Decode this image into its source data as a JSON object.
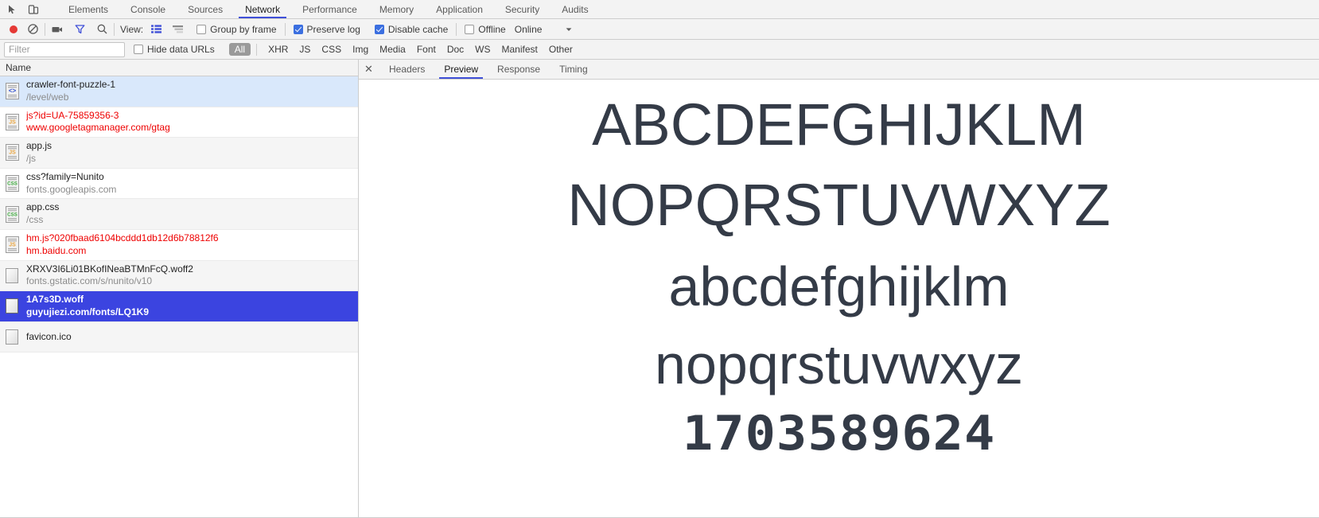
{
  "window": {
    "title": "Chrome DevTools — Network"
  },
  "devtools_tabs": {
    "inspect_icon": "inspect-element-icon",
    "device_icon": "device-toolbar-icon",
    "items": [
      {
        "label": "Elements",
        "active": false
      },
      {
        "label": "Console",
        "active": false
      },
      {
        "label": "Sources",
        "active": false
      },
      {
        "label": "Network",
        "active": true
      },
      {
        "label": "Performance",
        "active": false
      },
      {
        "label": "Memory",
        "active": false
      },
      {
        "label": "Application",
        "active": false
      },
      {
        "label": "Security",
        "active": false
      },
      {
        "label": "Audits",
        "active": false
      }
    ],
    "active_tab": "Network",
    "accent_color": "#4050d8"
  },
  "toolbar": {
    "record_icon": "record-circle-icon",
    "record_color": "#e53935",
    "clear_icon": "clear-no-entry-icon",
    "capture_screenshots_icon": "camera-icon",
    "filter_icon": "funnel-filter-icon",
    "filter_icon_color": "#4050d8",
    "search_icon": "magnifier-search-icon",
    "view_label": "View:",
    "view_list_icon": "list-view-icon",
    "view_list_active": true,
    "view_waterfall_icon": "waterfall-view-icon",
    "group_by_frame": {
      "label": "Group by frame",
      "checked": false
    },
    "preserve_log": {
      "label": "Preserve log",
      "checked": true
    },
    "disable_cache": {
      "label": "Disable cache",
      "checked": true
    },
    "offline": {
      "label": "Offline",
      "checked": false
    },
    "throttling_value": "Online",
    "throttling_caret_icon": "chevron-down-icon",
    "checkbox_color": "#3b6fe0"
  },
  "filterbar": {
    "filter_placeholder": "Filter",
    "filter_value": "",
    "hide_data_urls": {
      "label": "Hide data URLs",
      "checked": false
    },
    "types": [
      {
        "label": "All",
        "active": true
      },
      {
        "label": "XHR",
        "active": false
      },
      {
        "label": "JS",
        "active": false
      },
      {
        "label": "CSS",
        "active": false
      },
      {
        "label": "Img",
        "active": false
      },
      {
        "label": "Media",
        "active": false
      },
      {
        "label": "Font",
        "active": false
      },
      {
        "label": "Doc",
        "active": false
      },
      {
        "label": "WS",
        "active": false
      },
      {
        "label": "Manifest",
        "active": false
      },
      {
        "label": "Other",
        "active": false
      }
    ]
  },
  "request_list": {
    "column_header": "Name",
    "selected_color": "#3b44e0",
    "error_color": "#ee0000",
    "rows": [
      {
        "name": "crawler-font-puzzle-1",
        "path": "/level/web",
        "icon": "document-html-icon",
        "icon_label": "<>",
        "state": "highlight",
        "error": false
      },
      {
        "name": "js?id=UA-75859356-3",
        "path": "www.googletagmanager.com/gtag",
        "icon": "document-js-icon",
        "icon_label": "JS",
        "state": "even",
        "error": true
      },
      {
        "name": "app.js",
        "path": "/js",
        "icon": "document-js-icon",
        "icon_label": "JS",
        "state": "odd",
        "error": false
      },
      {
        "name": "css?family=Nunito",
        "path": "fonts.googleapis.com",
        "icon": "document-css-icon",
        "icon_label": "CSS",
        "state": "even",
        "error": false
      },
      {
        "name": "app.css",
        "path": "/css",
        "icon": "document-css-icon",
        "icon_label": "CSS",
        "state": "odd",
        "error": false
      },
      {
        "name": "hm.js?020fbaad6104bcddd1db12d6b78812f6",
        "path": "hm.baidu.com",
        "icon": "document-js-icon",
        "icon_label": "JS",
        "state": "even",
        "error": true
      },
      {
        "name": "XRXV3I6Li01BKofINeaBTMnFcQ.woff2",
        "path": "fonts.gstatic.com/s/nunito/v10",
        "icon": "document-blank-icon",
        "icon_label": "",
        "state": "odd",
        "error": false
      },
      {
        "name": "1A7s3D.woff",
        "path": "guyujiezi.com/fonts/LQ1K9",
        "icon": "document-blank-icon",
        "icon_label": "",
        "state": "selected",
        "error": false
      },
      {
        "name": "favicon.ico",
        "path": "",
        "icon": "document-blank-icon",
        "icon_label": "",
        "state": "odd",
        "error": false
      }
    ]
  },
  "detail_panel": {
    "close_icon": "close-x-icon",
    "tabs": [
      {
        "label": "Headers",
        "active": false
      },
      {
        "label": "Preview",
        "active": true
      },
      {
        "label": "Response",
        "active": false
      },
      {
        "label": "Timing",
        "active": false
      }
    ],
    "active_tab": "Preview",
    "font_preview": {
      "text_color": "#343b47",
      "lines": [
        "ABCDEFGHIJKLM",
        "NOPQRSTUVWXYZ",
        "abcdefghijklm",
        "nopqrstuvwxyz",
        "1703589624"
      ]
    }
  }
}
